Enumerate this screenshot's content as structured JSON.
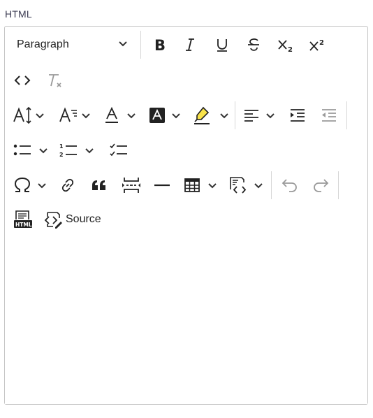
{
  "field": {
    "label": "HTML"
  },
  "toolbar": {
    "heading": {
      "selected": "Paragraph"
    },
    "source_label": "Source"
  }
}
